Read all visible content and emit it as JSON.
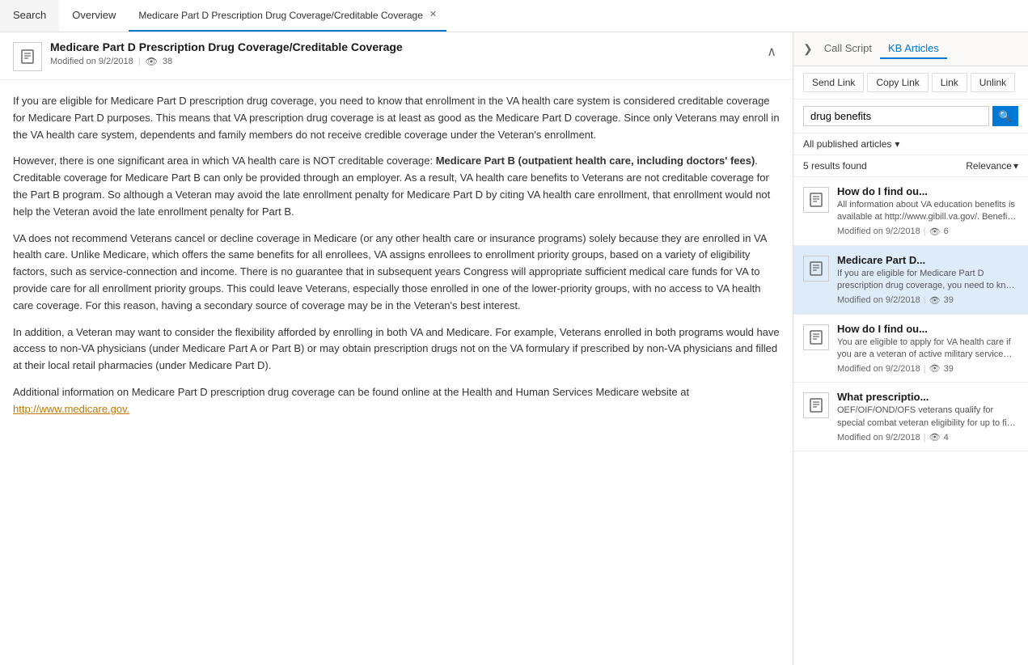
{
  "nav": {
    "items": [
      {
        "id": "search",
        "label": "Search",
        "active": false
      },
      {
        "id": "overview",
        "label": "Overview",
        "active": false
      },
      {
        "id": "article",
        "label": "Medicare Part D Prescription Drug Coverage/Creditable Coverage",
        "active": true
      }
    ]
  },
  "article": {
    "title": "Medicare Part D Prescription Drug Coverage/Creditable Coverage",
    "modified": "Modified on 9/2/2018",
    "views": "38",
    "body_paragraphs": [
      "If you are eligible for Medicare Part D prescription drug coverage, you need to know that enrollment in the VA health care system is considered creditable coverage for Medicare Part D purposes. This means that VA prescription drug coverage is at least as good as the Medicare Part D coverage. Since only Veterans may enroll in the VA health care system, dependents and family members do not receive credible coverage under the Veteran's enrollment.",
      "However, there is one significant area in which VA health care is NOT creditable coverage: Medicare Part B (outpatient health care, including doctors' fees). Creditable coverage for Medicare Part B can only be provided through an employer. As a result, VA health care benefits to Veterans are not creditable coverage for the Part B program. So although a Veteran may avoid the late enrollment penalty for Medicare Part D by citing VA health care enrollment, that enrollment would not help the Veteran avoid the late enrollment penalty for Part B.",
      "VA does not recommend Veterans cancel or decline coverage in Medicare (or any other health care or insurance programs) solely because they are enrolled in VA health care. Unlike Medicare, which offers the same benefits for all enrollees, VA assigns enrollees to enrollment priority groups, based on a variety of eligibility factors, such as service-connection and income. There is no guarantee that in subsequent years Congress will appropriate sufficient medical care funds for VA to provide care for all enrollment priority groups. This could leave Veterans, especially those enrolled in one of the lower-priority groups, with no access to VA health care coverage. For this reason, having a secondary source of coverage may be in the Veteran's best interest.",
      "In addition, a Veteran may want to consider the flexibility afforded by enrolling in both VA and Medicare. For example, Veterans enrolled in both programs would have access to non-VA physicians (under Medicare Part A or Part B) or may obtain prescription drugs not on the VA formulary if prescribed by non-VA physicians and filled at their local retail pharmacies (under Medicare Part D).",
      "Additional information on Medicare Part D prescription drug coverage can be found online at the Health and Human Services Medicare website at",
      "http://www.medicare.gov."
    ],
    "link_text": "http://www.medicare.gov.",
    "bold_phrase": "Medicare Part B (outpatient health care, including doctors' fees)"
  },
  "right_panel": {
    "header": {
      "expand_icon": "❯",
      "tabs": [
        {
          "id": "call_script",
          "label": "Call Script"
        },
        {
          "id": "kb_articles",
          "label": "KB Articles",
          "active": true
        }
      ]
    },
    "action_buttons": [
      {
        "id": "send_link",
        "label": "Send Link"
      },
      {
        "id": "copy_link",
        "label": "Copy Link"
      },
      {
        "id": "link",
        "label": "Link"
      },
      {
        "id": "unlink",
        "label": "Unlink"
      }
    ],
    "search": {
      "placeholder": "drug benefits",
      "value": "drug benefits",
      "button_icon": "🔍"
    },
    "filter": {
      "label": "All published articles",
      "dropdown_icon": "▾"
    },
    "results": {
      "count_text": "5 results found",
      "sort_label": "Relevance",
      "sort_icon": "▾"
    },
    "kb_items": [
      {
        "id": "item1",
        "title": "How do I find ou...",
        "description": "All information about VA education benefits is available at http://www.gibill.va.gov/.  Benefits and",
        "modified": "Modified on 9/2/2018",
        "views": "6",
        "selected": false
      },
      {
        "id": "item2",
        "title": "Medicare Part D...",
        "description": "If you are eligible for Medicare Part D prescription drug coverage, you need to know that enrollment in",
        "modified": "Modified on 9/2/2018",
        "views": "39",
        "selected": true
      },
      {
        "id": "item3",
        "title": "How do I find ou...",
        "description": "You are eligible to apply for VA health care if you are a veteran of active military service and were",
        "modified": "Modified on 9/2/2018",
        "views": "39",
        "selected": false
      },
      {
        "id": "item4",
        "title": "What prescriptio...",
        "description": "OEF/OIF/OND/OFS veterans qualify for special combat veteran eligibility for up to five years after",
        "modified": "Modified on 9/2/2018",
        "views": "4",
        "selected": false
      }
    ]
  }
}
